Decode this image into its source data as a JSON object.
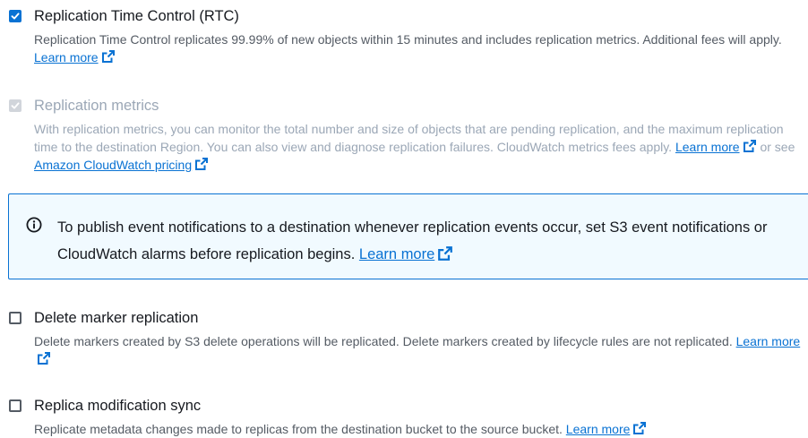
{
  "rtc": {
    "title": "Replication Time Control (RTC)",
    "checked": true,
    "description": "Replication Time Control replicates 99.99% of new objects within 15 minutes and includes replication metrics. Additional fees will apply.",
    "link": "Learn more"
  },
  "metrics": {
    "title": "Replication metrics",
    "checked": true,
    "disabled": true,
    "description": "With replication metrics, you can monitor the total number and size of objects that are pending replication, and the maximum replication time to the destination Region. You can also view and diagnose replication failures. CloudWatch metrics fees apply.",
    "link": "Learn more",
    "or_see": "or see",
    "pricing_link": "Amazon CloudWatch pricing"
  },
  "alert": {
    "line1": "To publish event notifications to a destination whenever replication events occur, set S3 event notifications or",
    "line2": "CloudWatch alarms before replication begins.",
    "link": "Learn more",
    "icon": "info-icon"
  },
  "delete_marker": {
    "title": "Delete marker replication",
    "checked": false,
    "description": "Delete markers created by S3 delete operations will be replicated. Delete markers created by lifecycle rules are not replicated.",
    "link": "Learn more"
  },
  "replica_sync": {
    "title": "Replica modification sync",
    "checked": false,
    "description": "Replicate metadata changes made to replicas from the destination bucket to the source bucket.",
    "link": "Learn more"
  },
  "colors": {
    "link": "#0972d3",
    "text": "#16191f",
    "secondary_text": "#545b64",
    "disabled_text": "#9ba7b6",
    "alert_background": "#f1faff",
    "alert_border": "#0972d3"
  }
}
